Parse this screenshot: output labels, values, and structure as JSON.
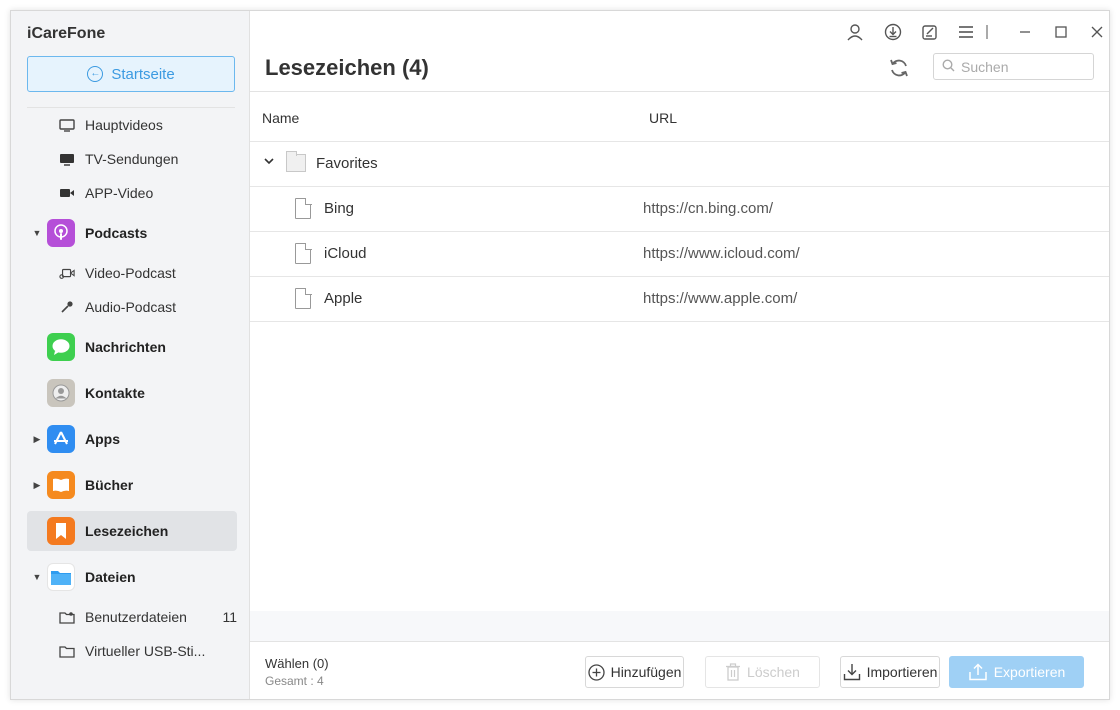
{
  "app": {
    "title": "iCareFone"
  },
  "sidebar": {
    "home_label": "Startseite",
    "video_items": [
      {
        "label": "Hauptvideos",
        "icon": "monitor-icon"
      },
      {
        "label": "TV-Sendungen",
        "icon": "tv-icon"
      },
      {
        "label": "APP-Video",
        "icon": "video-camera-icon"
      }
    ],
    "podcasts": {
      "label": "Podcasts",
      "icon": "podcasts-icon",
      "color": "#b54fd8"
    },
    "podcast_items": [
      {
        "label": "Video-Podcast",
        "icon": "video-podcast-icon"
      },
      {
        "label": "Audio-Podcast",
        "icon": "microphone-icon"
      }
    ],
    "nachrichten": {
      "label": "Nachrichten",
      "icon": "messages-icon",
      "color": "#3ecf4f"
    },
    "kontakte": {
      "label": "Kontakte",
      "icon": "contacts-icon",
      "color": "#b9b9b9"
    },
    "apps": {
      "label": "Apps",
      "icon": "app-store-icon",
      "color": "#2f8df1"
    },
    "buecher": {
      "label": "Bücher",
      "icon": "books-icon",
      "color": "#f58a1f"
    },
    "lesezeichen": {
      "label": "Lesezeichen",
      "icon": "bookmark-icon",
      "color": "#f47a1f"
    },
    "dateien": {
      "label": "Dateien",
      "icon": "files-icon",
      "color": "#2d9cf0"
    },
    "file_items": [
      {
        "label": "Benutzerdateien",
        "icon": "user-folder-icon",
        "count": "11"
      },
      {
        "label": "Virtueller USB-Sti...",
        "icon": "folder-icon"
      }
    ]
  },
  "header": {
    "title": "Lesezeichen (4)",
    "search_placeholder": "Suchen"
  },
  "table": {
    "columns": {
      "name": "Name",
      "url": "URL"
    },
    "folder": "Favorites",
    "rows": [
      {
        "name": "Bing",
        "url": "https://cn.bing.com/"
      },
      {
        "name": "iCloud",
        "url": "https://www.icloud.com/"
      },
      {
        "name": "Apple",
        "url": "https://www.apple.com/"
      }
    ]
  },
  "footer": {
    "selected": "Wählen (0)",
    "total": "Gesamt : 4",
    "add": "Hinzufügen",
    "delete": "Löschen",
    "import": "Importieren",
    "export": "Exportieren"
  },
  "colors": {
    "accent": "#3b9ae1",
    "export_disabled": "#9fd0f5"
  }
}
